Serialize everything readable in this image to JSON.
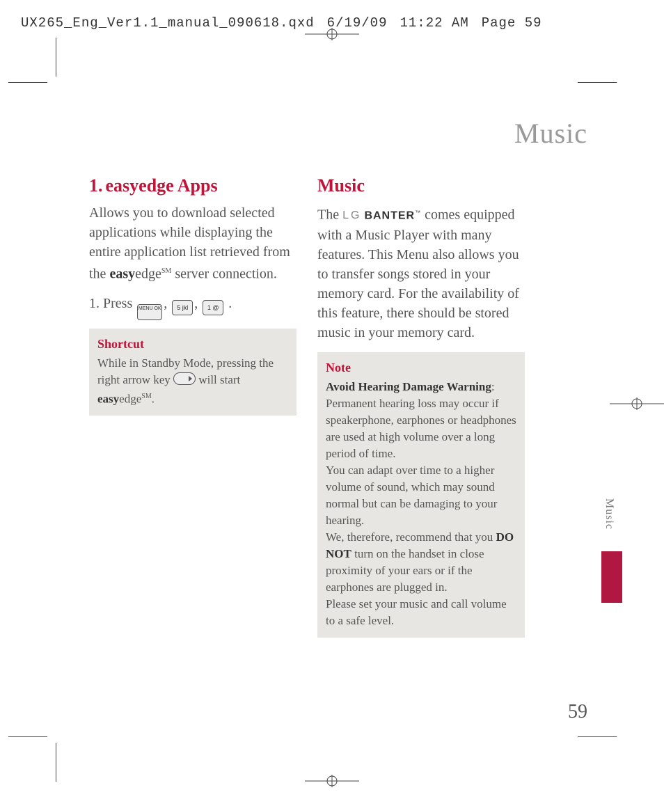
{
  "header": {
    "filename": "UX265_Eng_Ver1.1_manual_090618.qxd",
    "date": "6/19/09",
    "time": "11:22 AM",
    "pageinfo": "Page 59"
  },
  "page_title": "Music",
  "side_tab": "Music",
  "page_number": "59",
  "left": {
    "heading_num": "1.",
    "heading_text": "easyedge Apps",
    "intro_a": "Allows you to download selected applications while displaying the entire application list retrieved from the ",
    "intro_brand_bold": "easy",
    "intro_brand_rest": "edge",
    "intro_sm": "SM",
    "intro_b": " server connection.",
    "step_prefix": "1. Press ",
    "step_sep": ", ",
    "step_end": " .",
    "key1": "MENU OK",
    "key2": "5 jkl",
    "key3": "1 @",
    "shortcut": {
      "title": "Shortcut",
      "text_a": "While in Standby Mode, pressing the right arrow key ",
      "text_b": " will start ",
      "brand_bold": "easy",
      "brand_rest": "edge",
      "sm": "SM",
      "end": "."
    }
  },
  "right": {
    "heading": "Music",
    "intro_a": "The ",
    "brand_lg": "LG",
    "brand_name": "BANTER",
    "brand_tm": "™",
    "intro_b": " comes equipped with a Music Player with many features. This Menu also allows you to transfer songs stored in your memory card. For the availability of this feature, there should be stored music in your memory card.",
    "note": {
      "title": "Note",
      "warn_label": "Avoid Hearing Damage Warning",
      "warn_colon": ":",
      "p1": "Permanent hearing loss may occur if speakerphone, earphones or headphones are used at high volume over a long period of time.",
      "p2": "You can adapt over time to a higher volume of sound, which may sound normal but can be damaging to your hearing.",
      "p3a": "We, therefore, recommend that you ",
      "p3_bold": "DO NOT",
      "p3b": " turn on the handset in close proximity of your ears or if the earphones are plugged in.",
      "p4": "Please set your music and call volume to a safe level."
    }
  }
}
